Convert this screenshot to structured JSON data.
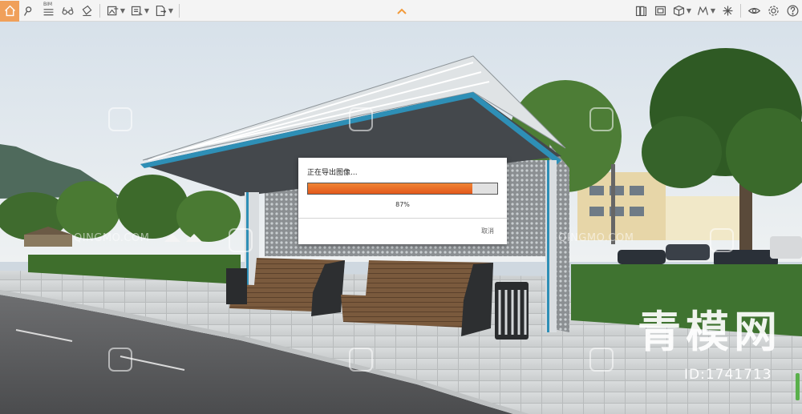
{
  "toolbar": {
    "bim_label": "BIM"
  },
  "dialog": {
    "title": "正在导出图像...",
    "progress": 0.87,
    "percent_label": "87%",
    "cancel_label": "取消"
  },
  "watermarks": {
    "site_text": "QINGMO.COM",
    "big_text": "青模网",
    "id_text": "ID:1741713"
  },
  "colors": {
    "progress_fill": "#e9641f",
    "home_button": "#f0a05a"
  }
}
